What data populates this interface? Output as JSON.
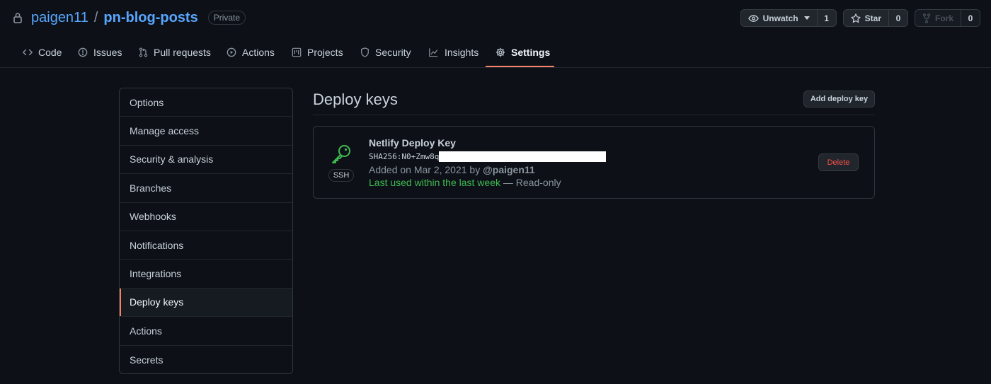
{
  "repo": {
    "owner": "paigen11",
    "separator": "/",
    "name": "pn-blog-posts",
    "visibility": "Private"
  },
  "actions": {
    "watch": {
      "label": "Unwatch",
      "count": "1"
    },
    "star": {
      "label": "Star",
      "count": "0"
    },
    "fork": {
      "label": "Fork",
      "count": "0"
    }
  },
  "tabs": [
    {
      "label": "Code",
      "icon": "code-icon"
    },
    {
      "label": "Issues",
      "icon": "issue-opened-icon"
    },
    {
      "label": "Pull requests",
      "icon": "git-pull-request-icon"
    },
    {
      "label": "Actions",
      "icon": "play-icon"
    },
    {
      "label": "Projects",
      "icon": "project-icon"
    },
    {
      "label": "Security",
      "icon": "shield-icon"
    },
    {
      "label": "Insights",
      "icon": "graph-icon"
    },
    {
      "label": "Settings",
      "icon": "gear-icon",
      "selected": true
    }
  ],
  "menu": [
    "Options",
    "Manage access",
    "Security & analysis",
    "Branches",
    "Webhooks",
    "Notifications",
    "Integrations",
    "Deploy keys",
    "Actions",
    "Secrets"
  ],
  "menu_selected": "Deploy keys",
  "main": {
    "title": "Deploy keys",
    "add_button": "Add deploy key",
    "key": {
      "title": "Netlify Deploy Key",
      "type": "SSH",
      "fingerprint": "SHA256:N0+Zmw8q",
      "added_prefix": "Added on Mar 2, 2021 by",
      "added_by": "@paigen11",
      "last_used": "Last used within the last week",
      "access": "— Read-only",
      "delete_button": "Delete"
    }
  },
  "colors": {
    "accent": "#f78166",
    "link": "#58a6ff",
    "success": "#3fb950",
    "danger": "#f85149",
    "background": "#0d1117"
  }
}
